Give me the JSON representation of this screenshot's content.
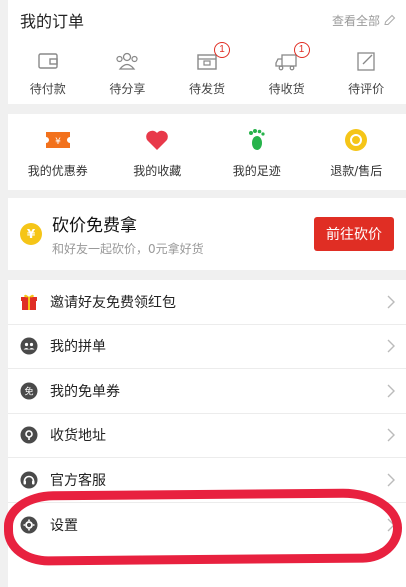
{
  "orders": {
    "title": "我的订单",
    "view_all": "查看全部",
    "items": [
      {
        "label": "待付款",
        "icon": "wallet-icon",
        "badge": ""
      },
      {
        "label": "待分享",
        "icon": "share-people-icon",
        "badge": ""
      },
      {
        "label": "待发货",
        "icon": "package-icon",
        "badge": "1"
      },
      {
        "label": "待收货",
        "icon": "truck-icon",
        "badge": "1"
      },
      {
        "label": "待评价",
        "icon": "review-icon",
        "badge": ""
      }
    ]
  },
  "shortcuts": [
    {
      "label": "我的优惠券",
      "icon": "coupon-icon",
      "color": "#f2711c"
    },
    {
      "label": "我的收藏",
      "icon": "heart-icon",
      "color": "#e8394a"
    },
    {
      "label": "我的足迹",
      "icon": "footprint-icon",
      "color": "#27b34b"
    },
    {
      "label": "退款/售后",
      "icon": "refund-icon",
      "color": "#f5c518"
    }
  ],
  "bargain": {
    "coin": "¥",
    "title": "砍价免费拿",
    "subtitle": "和好友一起砍价，0元拿好货",
    "button": "前往砍价"
  },
  "menu": [
    {
      "label": "邀请好友免费领红包",
      "icon": "gift-icon"
    },
    {
      "label": "我的拼单",
      "icon": "group-icon"
    },
    {
      "label": "我的免单券",
      "icon": "free-coupon-icon"
    },
    {
      "label": "收货地址",
      "icon": "location-icon"
    },
    {
      "label": "官方客服",
      "icon": "headset-icon"
    },
    {
      "label": "设置",
      "icon": "gear-icon"
    }
  ],
  "colors": {
    "accent": "#e02e24",
    "highlight": "#e8213f"
  }
}
